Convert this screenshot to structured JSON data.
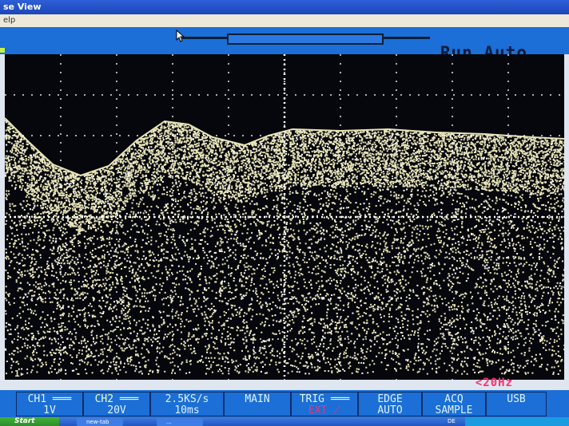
{
  "window": {
    "title": "se View",
    "menu": "elp"
  },
  "scope": {
    "run_status": "Run Auto",
    "trigger_marker": "1",
    "freq_readout": "<20Hz"
  },
  "menu": {
    "ch1": {
      "top": "CH1",
      "bottom": "1V"
    },
    "ch2": {
      "top": "CH2",
      "bottom": "20V"
    },
    "sample_rate": {
      "top": "2.5KS/s",
      "bottom": "10ms"
    },
    "main": {
      "top": "MAIN"
    },
    "trig": {
      "top": "TRIG",
      "bottom": "EXT"
    },
    "edge": {
      "top": "EDGE",
      "bottom": "AUTO"
    },
    "acq": {
      "top": "ACQ",
      "bottom": "SAMPLE"
    },
    "usb": {
      "top": "USB"
    }
  },
  "taskbar": {
    "start_label": "Start",
    "items": [
      "new-tab",
      "..."
    ],
    "lang": "DE"
  },
  "colors": {
    "screen_bg": "#06070c",
    "trace": "#e8e4b8",
    "ui_blue": "#1b6fd6",
    "readout_red": "#ff2d6e"
  }
}
